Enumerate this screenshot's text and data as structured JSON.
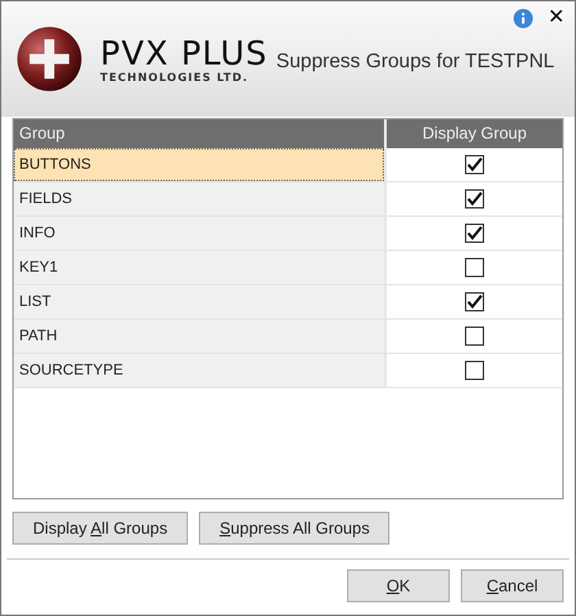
{
  "header": {
    "logo_title": "PVX PLUS",
    "logo_subtitle": "TECHNOLOGIES LTD.",
    "title": "Suppress Groups for TESTPNL",
    "close_glyph": "✕"
  },
  "table": {
    "columns": [
      "Group",
      "Display Group"
    ],
    "rows": [
      {
        "group": "BUTTONS",
        "checked": true,
        "selected": true
      },
      {
        "group": "FIELDS",
        "checked": true,
        "selected": false
      },
      {
        "group": "INFO",
        "checked": true,
        "selected": false
      },
      {
        "group": "KEY1",
        "checked": false,
        "selected": false
      },
      {
        "group": "LIST",
        "checked": true,
        "selected": false
      },
      {
        "group": "PATH",
        "checked": false,
        "selected": false
      },
      {
        "group": "SOURCETYPE",
        "checked": false,
        "selected": false
      }
    ]
  },
  "group_buttons": [
    {
      "before": "Display ",
      "hotkey": "A",
      "after": "ll Groups"
    },
    {
      "hotkey": "S",
      "after": "uppress All Groups"
    }
  ],
  "dialog_buttons": [
    {
      "hotkey": "O",
      "after": "K"
    },
    {
      "hotkey": "C",
      "after": "ancel"
    }
  ]
}
